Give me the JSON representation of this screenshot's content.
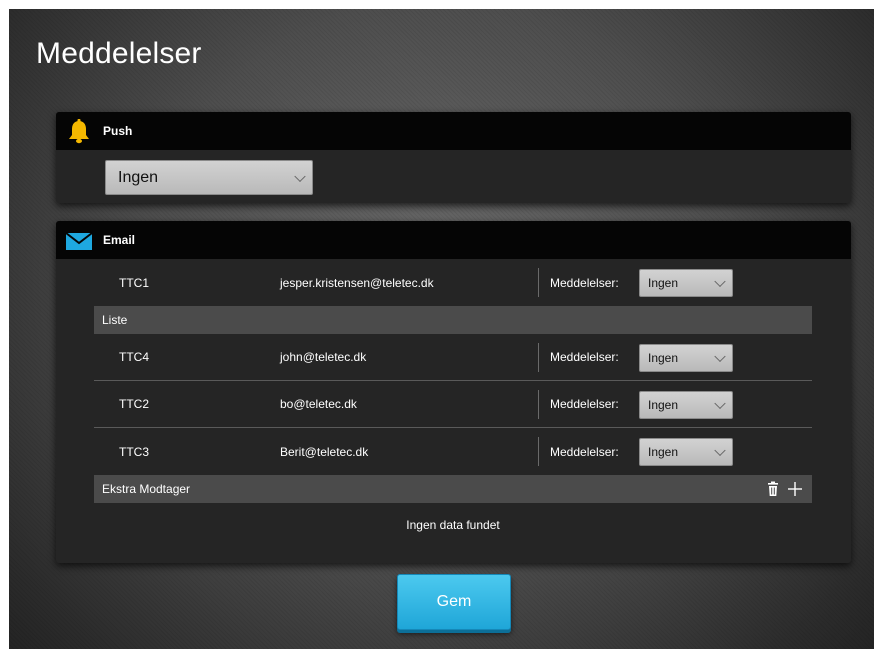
{
  "page": {
    "title": "Meddelelser"
  },
  "push": {
    "title": "Push",
    "icon": "bell-icon",
    "icon_color": "#f5b800",
    "selected": "Ingen"
  },
  "email": {
    "title": "Email",
    "icon": "envelope-icon",
    "icon_color": "#1ea8e0",
    "primary": {
      "name": "TTC1",
      "email": "jesper.kristensen@teletec.dk",
      "notif_label": "Meddelelser:",
      "notif_value": "Ingen"
    },
    "list_label": "Liste",
    "list": [
      {
        "name": "TTC4",
        "email": "john@teletec.dk",
        "notif_label": "Meddelelser:",
        "notif_value": "Ingen"
      },
      {
        "name": "TTC2",
        "email": "bo@teletec.dk",
        "notif_label": "Meddelelser:",
        "notif_value": "Ingen"
      },
      {
        "name": "TTC3",
        "email": "Berit@teletec.dk",
        "notif_label": "Meddelelser:",
        "notif_value": "Ingen"
      }
    ],
    "extra_label": "Ekstra Modtager",
    "extra_icons": [
      "trash-icon",
      "plus-icon"
    ],
    "no_data": "Ingen data fundet"
  },
  "actions": {
    "save_label": "Gem",
    "save_color": "#29b3e3"
  }
}
